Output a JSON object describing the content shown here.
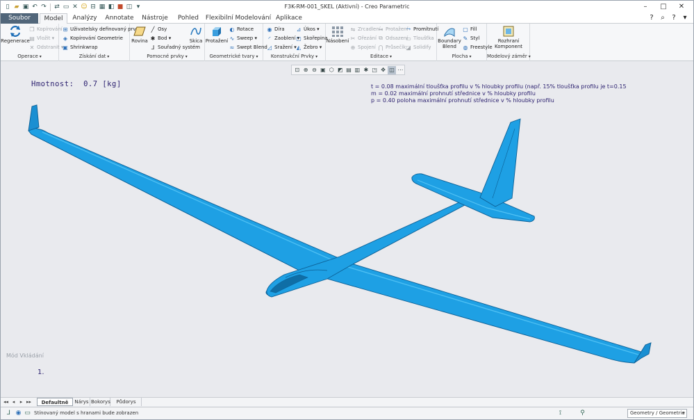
{
  "window": {
    "title": "F3K-RM-001_SKEL (Aktivní) - Creo Parametric",
    "controls": [
      "–",
      "□",
      "✕"
    ]
  },
  "quick_access": [
    "new-icon",
    "open-icon",
    "save-icon",
    "undo-icon",
    "redo-icon",
    "regenerate-icon",
    "window-icon",
    "close-window-icon",
    "smiley-icon",
    "units-icon",
    "display-icon",
    "appearance-icon",
    "customize-icon"
  ],
  "tabs": [
    "Soubor",
    "Model",
    "Analýzy",
    "Annotate",
    "Nástroje",
    "Pohled",
    "Flexibilní Modelování",
    "Aplikace"
  ],
  "active_tab": "Model",
  "ribbon": {
    "groups": [
      {
        "label": "Operace",
        "big": [
          {
            "label": "Regenerace",
            "icon": "regenerate-icon"
          }
        ],
        "small": [
          {
            "label": "Kopírování",
            "disabled": true
          },
          {
            "label": "Vložit ▾",
            "disabled": true
          },
          {
            "label": "Odstranit ▾",
            "disabled": true
          }
        ]
      },
      {
        "label": "Získání dat",
        "small": [
          {
            "label": "Uživatelsky definovaný prvek",
            "disabled": false
          },
          {
            "label": "Kopírování Geometrie",
            "disabled": false
          },
          {
            "label": "Shrinkwrap",
            "disabled": false
          }
        ]
      },
      {
        "label": "Pomocné prvky",
        "big": [
          {
            "label": "Rovina",
            "icon": "plane-icon"
          },
          {
            "label": "Skica",
            "icon": "sketch-icon"
          }
        ],
        "small": [
          {
            "label": "Osy",
            "disabled": false
          },
          {
            "label": "Bod ▾",
            "disabled": false
          },
          {
            "label": "Souřadný systém",
            "disabled": false
          }
        ]
      },
      {
        "label": "Geometrické tvary",
        "big": [
          {
            "label": "Protažení",
            "icon": "extrude-icon"
          }
        ],
        "small": [
          {
            "label": "Rotace",
            "disabled": false
          },
          {
            "label": "Sweep ▾",
            "disabled": false
          },
          {
            "label": "Swept Blend",
            "disabled": false
          }
        ]
      },
      {
        "label": "Konstrukční Prvky",
        "small": [
          {
            "label": "Díra",
            "disabled": false
          },
          {
            "label": "Zaoblení ▾",
            "disabled": false
          },
          {
            "label": "Sražení ▾",
            "disabled": false
          },
          {
            "label": "Úkos ▾",
            "disabled": false
          },
          {
            "label": "Skořepina",
            "disabled": false
          },
          {
            "label": "Žebro ▾",
            "disabled": false
          }
        ]
      },
      {
        "label": "Editace",
        "big": [
          {
            "label": "Násobení",
            "icon": "pattern-icon"
          }
        ],
        "small": [
          {
            "label": "Zrcadlení",
            "disabled": true
          },
          {
            "label": "Ořezání",
            "disabled": true
          },
          {
            "label": "Spojení",
            "disabled": true
          },
          {
            "label": "Protažení",
            "disabled": true
          },
          {
            "label": "Odsazení",
            "disabled": true
          },
          {
            "label": "Průsečík",
            "disabled": true
          },
          {
            "label": "Promítnutí",
            "disabled": false
          },
          {
            "label": "Tloušťka",
            "disabled": true
          },
          {
            "label": "Solidify",
            "disabled": true
          }
        ]
      },
      {
        "label": "Plocha",
        "big": [
          {
            "label": "Boundary Blend",
            "icon": "boundary-blend-icon"
          }
        ],
        "small": [
          {
            "label": "Fill",
            "disabled": false
          },
          {
            "label": "Styl",
            "disabled": false
          },
          {
            "label": "Freestyle",
            "disabled": false
          }
        ]
      },
      {
        "label": "Modelový záměr",
        "big": [
          {
            "label": "Rozhraní Komponent",
            "icon": "component-interface-icon"
          }
        ]
      }
    ]
  },
  "view_toolbar": [
    "refit-icon",
    "zoom-in-icon",
    "zoom-out-icon",
    "repaint-icon",
    "perspective-icon",
    "display-style-icon",
    "saved-views-icon",
    "view-manager-icon",
    "datum-display-icon",
    "annotation-icon",
    "spin-center-icon",
    "hidden-line-icon",
    "more-icon"
  ],
  "graphics": {
    "mass_label": "Hmotnost:",
    "mass_value": "0.7 [kg]",
    "notes": [
      "t = 0.08 maximální tloušťka profilu v % hloubky profilu (např. 15% tloušťka profilu je t=0.15",
      "m = 0.02 maximální prohnutí střednice v % hloubky profilu",
      "p = 0.40 poloha maximální prohnutí střednice v % hloubky profilu"
    ],
    "mode": "Mód Vkládání",
    "mode_number": "1."
  },
  "colors": {
    "model": "#1ea0e4",
    "model_dark": "#0c5f95",
    "model_light": "#52c2f4",
    "file_tab": "#51667a",
    "annotation_text": "#2a1f6e"
  },
  "sheets": {
    "tabs": [
      "Defaultně Vše *",
      "Nárys",
      "Bokorys",
      "Půdorys"
    ],
    "active": "Defaultně Vše *"
  },
  "status": {
    "message": "Stínovaný model s hranami bude zobrazen",
    "filter": "Geometry / Geometrie"
  }
}
